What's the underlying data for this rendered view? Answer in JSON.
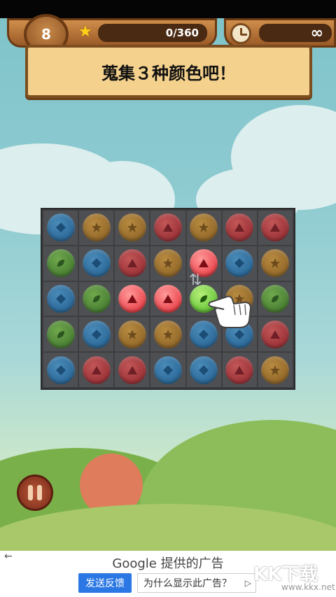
{
  "hud": {
    "moves": "8",
    "score": "0/360",
    "time": "∞"
  },
  "banner": {
    "text": "蒐集３种颜色吧！"
  },
  "board": {
    "rows": [
      [
        "blue",
        "orange",
        "orange",
        "red",
        "orange",
        "red",
        "red"
      ],
      [
        "green",
        "blue",
        "red",
        "orange",
        "red",
        "blue",
        "orange"
      ],
      [
        "blue",
        "green",
        "red",
        "red",
        "green",
        "orange",
        "green"
      ],
      [
        "green",
        "blue",
        "orange",
        "orange",
        "blue",
        "blue",
        "red"
      ],
      [
        "blue",
        "red",
        "red",
        "blue",
        "blue",
        "red",
        "orange"
      ]
    ],
    "highlighted": [
      [
        1,
        4
      ],
      [
        2,
        2
      ],
      [
        2,
        3
      ],
      [
        2,
        4
      ]
    ]
  },
  "icons": {
    "star": "star-icon",
    "clock": "clock-icon",
    "hand": "pointing-hand-icon",
    "pause": "pause-icon"
  },
  "ad": {
    "title": "Google 提供的广告",
    "feedback_label": "发送反馈",
    "why_label": "为什么显示此广告？",
    "back": "←",
    "play": "▷"
  },
  "watermark": {
    "text": "KK下载",
    "url": "www.kkx.net"
  },
  "colors": {
    "blue": "#0b5fa3",
    "orange": "#9a5f0c",
    "red": "#a4121b",
    "green": "#2f7a17",
    "banner": "#f4d18c",
    "wood": "#9a5a26"
  }
}
